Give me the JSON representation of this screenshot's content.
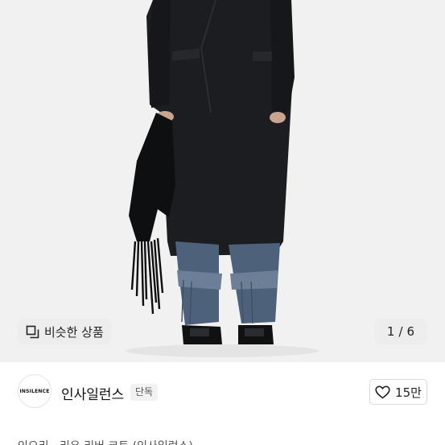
{
  "gallery": {
    "similar_label": "비슷한 상품",
    "similar_icon": "similar-items-icon",
    "current": "1",
    "separator": "/",
    "total": "6"
  },
  "brand": {
    "logo_text": "INSILENCE",
    "name": "인사일런스",
    "badge": "단독"
  },
  "like": {
    "icon": "heart-icon",
    "count": "15만"
  },
  "product": {
    "partial_title": "인오리 · 리유 리버 코트 (인사일런스)"
  }
}
